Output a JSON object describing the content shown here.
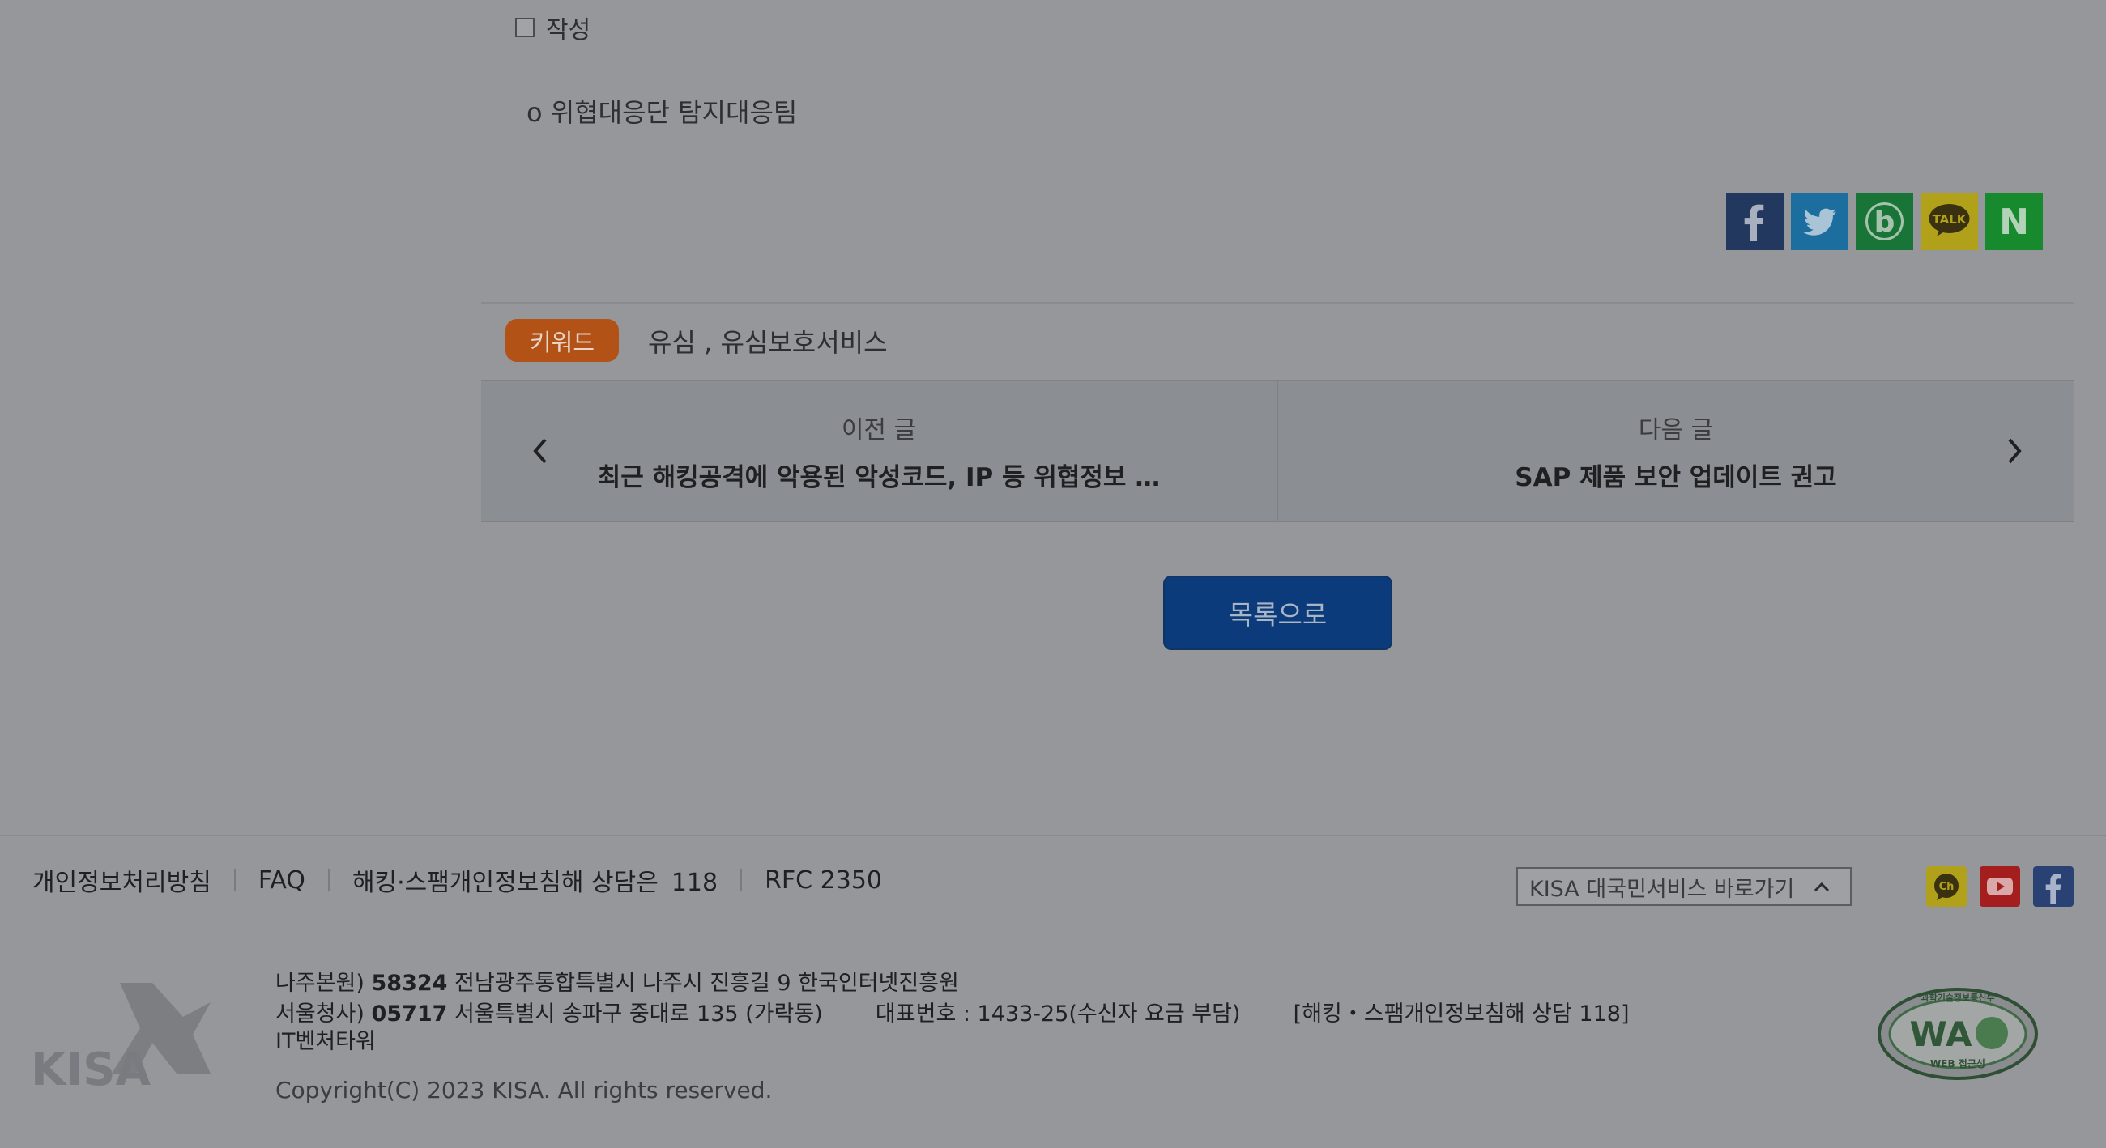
{
  "article": {
    "checkbox_label": "작성",
    "team_line": "o 위협대응단 탐지대응팀"
  },
  "share": {
    "icons": [
      "facebook-icon",
      "twitter-icon",
      "band-icon",
      "kakaotalk-icon",
      "naver-icon"
    ],
    "talk_text": "TALK",
    "naver_text": "N",
    "band_text": "b"
  },
  "keywords": {
    "badge": "키워드",
    "text": "유심 ,  유심보호서비스"
  },
  "post_nav": {
    "prev_label": "이전 글",
    "prev_title": "최근 해킹공격에 악용된 악성코드, IP 등 위협정보 …",
    "next_label": "다음 글",
    "next_title": "SAP 제품 보안 업데이트 권고"
  },
  "list_button": "목록으로",
  "footer": {
    "links": {
      "privacy": "개인정보처리방침",
      "faq": "FAQ",
      "hacking_label": "해킹·스팸개인정보침해 상담은",
      "hacking_number": "118",
      "rfc": "RFC 2350"
    },
    "site_select": "KISA 대국민서비스 바로가기",
    "social": {
      "channel_text": "Ch"
    },
    "logo_text": "KISA",
    "address": {
      "naju_prefix": "나주본원)",
      "naju_zip": "58324",
      "naju_addr": "전남광주통합특별시 나주시 진흥길 9 한국인터넷진흥원",
      "seoul_prefix": "서울청사)",
      "seoul_zip": "05717",
      "seoul_addr": "서울특별시 송파구 중대로 135 (가락동)",
      "main_phone": "대표번호 : 1433-25(수신자 요금 부담)",
      "hacking": "[해킹・스팸개인정보침해 상담 118]",
      "building": "IT벤처타워"
    },
    "copyright": "Copyright(C) 2023 KISA. All rights reserved.",
    "wa_badge": {
      "main": "WA",
      "sub": "WEB 접근성",
      "top": "과학기술정보통신부"
    }
  },
  "colors": {
    "overlay_bg": "#96979b",
    "keyword_badge": "#b25217",
    "list_button": "#0b3b7a",
    "facebook": "#23385e",
    "twitter": "#1b6e9e",
    "band": "#187437",
    "kakao": "#b1a01a",
    "naver": "#178a2e",
    "youtube": "#a51e1e"
  }
}
